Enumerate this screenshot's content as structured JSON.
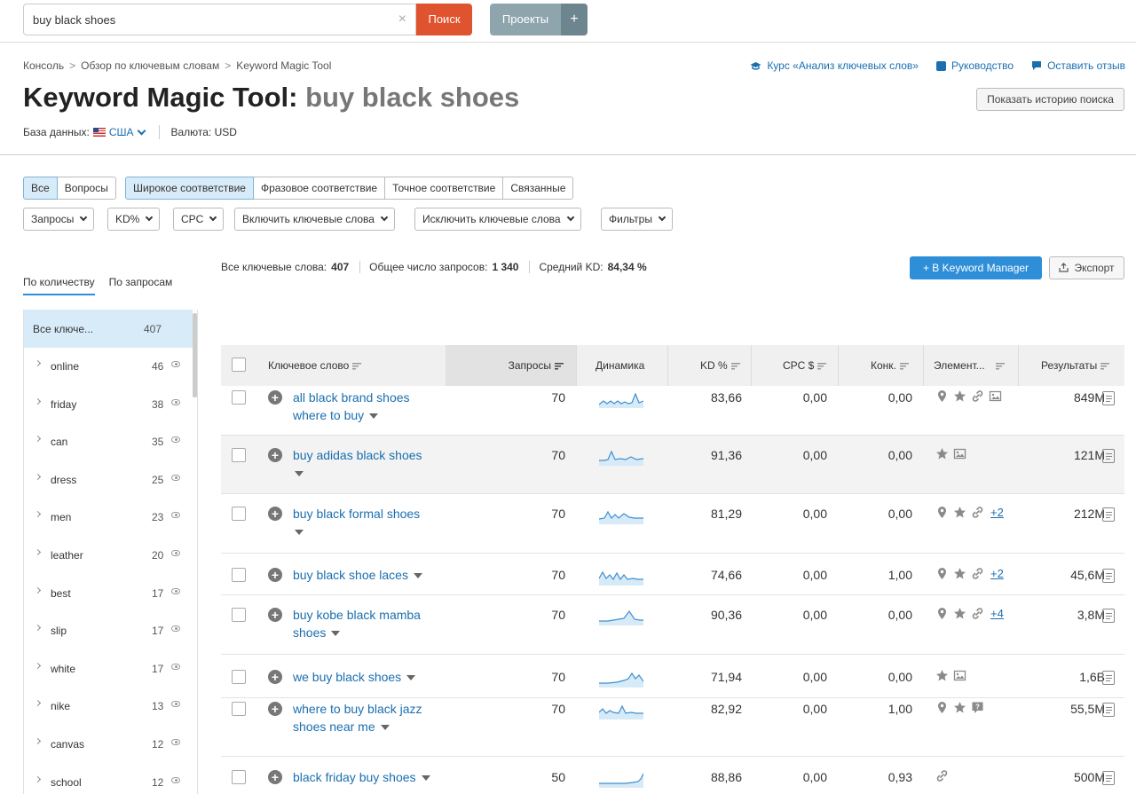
{
  "search": {
    "value": "buy black shoes",
    "button": "Поиск",
    "clear": "×"
  },
  "projects": {
    "label": "Проекты",
    "plus": "+"
  },
  "breadcrumb": [
    "Консоль",
    "Обзор по ключевым словам",
    "Keyword Magic Tool"
  ],
  "breadcrumb_sep": ">",
  "toplinks": {
    "course": "Курс «Анализ ключевых слов»",
    "guide": "Руководство",
    "feedback": "Оставить отзыв"
  },
  "title": {
    "prefix": "Keyword Magic Tool:",
    "query": "buy black shoes"
  },
  "history_button": "Показать историю поиска",
  "database": {
    "label": "База данных:",
    "country": "США",
    "currency_label": "Валюта: USD"
  },
  "match_tabs": [
    "Все",
    "Вопросы",
    "Широкое соответствие",
    "Фразовое соответствие",
    "Точное соответствие",
    "Связанные"
  ],
  "filters": [
    "Запросы",
    "KD%",
    "CPC",
    "Включить ключевые слова",
    "Исключить ключевые слова",
    "Фильтры"
  ],
  "summary": {
    "all_label": "Все ключевые слова:",
    "all_value": "407",
    "volume_label": "Общее число запросов:",
    "volume_value": "1 340",
    "kd_label": "Средний KD:",
    "kd_value": "84,34 %"
  },
  "actions": {
    "keyword_manager": "+ В Keyword Manager",
    "export": "Экспорт"
  },
  "side_tabs": [
    "По количеству",
    "По запросам"
  ],
  "sidebar": {
    "all": {
      "label": "Все ключе...",
      "count": "407"
    },
    "items": [
      {
        "label": "online",
        "count": "46"
      },
      {
        "label": "friday",
        "count": "38"
      },
      {
        "label": "can",
        "count": "35"
      },
      {
        "label": "dress",
        "count": "25"
      },
      {
        "label": "men",
        "count": "23"
      },
      {
        "label": "leather",
        "count": "20"
      },
      {
        "label": "best",
        "count": "17"
      },
      {
        "label": "slip",
        "count": "17"
      },
      {
        "label": "white",
        "count": "17"
      },
      {
        "label": "nike",
        "count": "13"
      },
      {
        "label": "canvas",
        "count": "12"
      },
      {
        "label": "school",
        "count": "12"
      }
    ]
  },
  "table": {
    "headers": {
      "keyword": "Ключевое слово",
      "volume": "Запросы",
      "trend": "Динамика",
      "kd": "KD %",
      "cpc": "CPC $",
      "comp": "Конк.",
      "features": "Элемент...",
      "results": "Результаты"
    },
    "rows": [
      {
        "kw1": "all black brand shoes",
        "kw2": "where to buy",
        "volume": "70",
        "kd": "83,66",
        "cpc": "0,00",
        "comp": "0,00",
        "features": [
          "pin-icon",
          "star-icon",
          "link-icon",
          "image-icon"
        ],
        "more": "",
        "results": "849M"
      },
      {
        "kw1": "buy adidas black shoes",
        "kw2": "",
        "volume": "70",
        "kd": "91,36",
        "cpc": "0,00",
        "comp": "0,00",
        "features": [
          "star-icon",
          "image-icon"
        ],
        "more": "",
        "results": "121M"
      },
      {
        "kw1": "buy black formal shoes",
        "kw2": "",
        "volume": "70",
        "kd": "81,29",
        "cpc": "0,00",
        "comp": "0,00",
        "features": [
          "pin-icon",
          "star-icon",
          "link-icon"
        ],
        "more": "+2",
        "results": "212M"
      },
      {
        "kw1": "buy black shoe laces",
        "kw2": "",
        "volume": "70",
        "kd": "74,66",
        "cpc": "0,00",
        "comp": "1,00",
        "features": [
          "pin-icon",
          "star-icon",
          "link-icon"
        ],
        "more": "+2",
        "results": "45,6M"
      },
      {
        "kw1": "buy kobe black mamba",
        "kw2": "shoes",
        "volume": "70",
        "kd": "90,36",
        "cpc": "0,00",
        "comp": "0,00",
        "features": [
          "pin-icon",
          "star-icon",
          "link-icon"
        ],
        "more": "+4",
        "results": "3,8M"
      },
      {
        "kw1": "we buy black shoes",
        "kw2": "",
        "volume": "70",
        "kd": "71,94",
        "cpc": "0,00",
        "comp": "0,00",
        "features": [
          "star-icon",
          "image-icon"
        ],
        "more": "",
        "results": "1,6B"
      },
      {
        "kw1": "where to buy black jazz",
        "kw2": "shoes near me",
        "volume": "70",
        "kd": "82,92",
        "cpc": "0,00",
        "comp": "1,00",
        "features": [
          "pin-icon",
          "star-icon",
          "question-icon"
        ],
        "more": "",
        "results": "55,5M"
      },
      {
        "kw1": "black friday buy shoes",
        "kw2": "",
        "volume": "50",
        "kd": "88,86",
        "cpc": "0,00",
        "comp": "0,93",
        "features": [
          "link-icon"
        ],
        "more": "",
        "results": "500M"
      }
    ]
  },
  "colors": {
    "accent": "#1a6fb0",
    "search_button": "#e0532f",
    "primary_button": "#2e8fd8",
    "active_tab": "#d8ebf8"
  }
}
